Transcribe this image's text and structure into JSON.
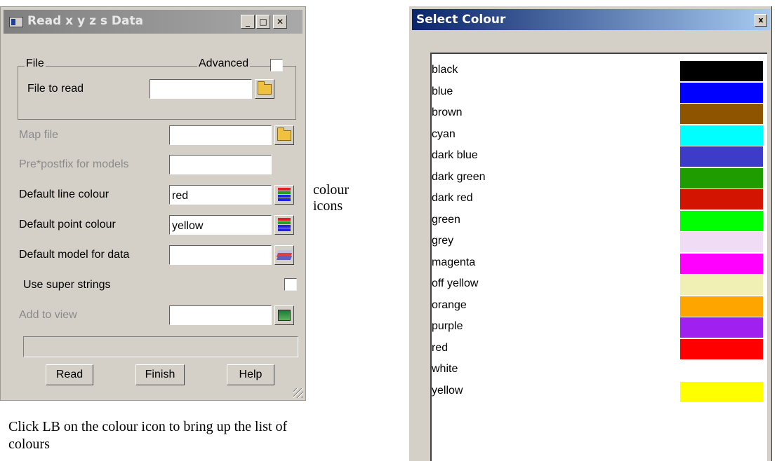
{
  "read_dialog": {
    "title": "Read x y z s Data",
    "min_glyph": "_",
    "max_glyph": "□",
    "close_glyph": "✕",
    "file_group": "File",
    "advanced_label": "Advanced",
    "advanced_checked": false,
    "file_to_read_label": "File to read",
    "file_to_read_value": "",
    "map_file_label": "Map file",
    "map_file_value": "",
    "prepostfix_label": "Pre*postfix for models",
    "prepostfix_value": "",
    "line_colour_label": "Default line colour",
    "line_colour_value": "red",
    "point_colour_label": "Default point colour",
    "point_colour_value": "yellow",
    "model_label": "Default model for data",
    "model_value": "",
    "super_strings_label": "Use super strings",
    "super_strings_checked": false,
    "add_view_label": "Add to view",
    "add_view_value": "",
    "status_text": "",
    "read_button": "Read",
    "finish_button": "Finish",
    "help_button": "Help"
  },
  "annotations": {
    "colour_icons_line1": "colour",
    "colour_icons_line2": "icons",
    "caption_line1": "Click LB on the colour icon to bring up the list of",
    "caption_line2": "colours"
  },
  "select_colour": {
    "title": "Select Colour",
    "close_glyph": "x",
    "colours": [
      {
        "name": "black",
        "hex": "#000000"
      },
      {
        "name": "blue",
        "hex": "#0000ff"
      },
      {
        "name": "brown",
        "hex": "#8f5400"
      },
      {
        "name": "cyan",
        "hex": "#00ffff"
      },
      {
        "name": "dark blue",
        "hex": "#3c3cc8"
      },
      {
        "name": "dark green",
        "hex": "#1f9c00"
      },
      {
        "name": "dark red",
        "hex": "#d21400"
      },
      {
        "name": "green",
        "hex": "#00ff00"
      },
      {
        "name": "grey",
        "hex": "#f0dcf5"
      },
      {
        "name": "magenta",
        "hex": "#ff00ff"
      },
      {
        "name": "off yellow",
        "hex": "#f0f0b4"
      },
      {
        "name": "orange",
        "hex": "#ffa500"
      },
      {
        "name": "purple",
        "hex": "#a020f0"
      },
      {
        "name": "red",
        "hex": "#ff0000"
      },
      {
        "name": "white",
        "hex": "#ffffff"
      },
      {
        "name": "yellow",
        "hex": "#ffff00"
      }
    ]
  },
  "icons": {
    "folder": "folder-icon",
    "colour": "colour-list-icon",
    "model": "layers-icon",
    "view": "view-icon"
  }
}
